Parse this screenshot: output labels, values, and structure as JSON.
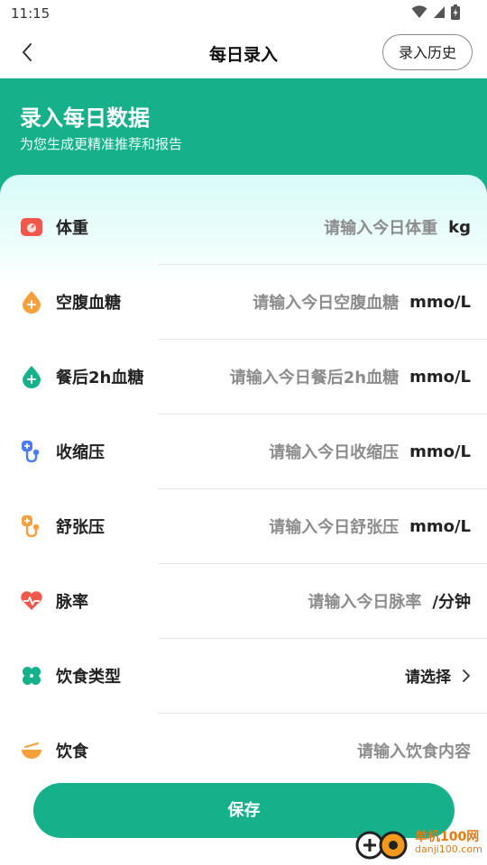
{
  "status_bar": {
    "time": "11:15"
  },
  "header": {
    "title": "每日录入",
    "history_button": "录入历史"
  },
  "banner": {
    "title": "录入每日数据",
    "subtitle": "为您生成更精准推荐和报告"
  },
  "form": {
    "rows": [
      {
        "label": "体重",
        "placeholder": "请输入今日体重",
        "unit": "kg"
      },
      {
        "label": "空腹血糖",
        "placeholder": "请输入今日空腹血糖",
        "unit": "mmo/L"
      },
      {
        "label": "餐后2h血糖",
        "placeholder": "请输入今日餐后2h血糖",
        "unit": "mmo/L"
      },
      {
        "label": "收缩压",
        "placeholder": "请输入今日收缩压",
        "unit": "mmo/L"
      },
      {
        "label": "舒张压",
        "placeholder": "请输入今日舒张压",
        "unit": "mmo/L"
      },
      {
        "label": "脉率",
        "placeholder": "请输入今日脉率",
        "unit": "/分钟"
      },
      {
        "label": "饮食类型",
        "select_value": "请选择"
      },
      {
        "label": "饮食",
        "placeholder": "请输入饮食内容"
      }
    ]
  },
  "save_button": "保存",
  "watermark": {
    "name": "单机100网",
    "domain": "danji100.com"
  },
  "colors": {
    "primary": "#16b08a",
    "orange": "#f5a03a",
    "red": "#f2574c"
  }
}
